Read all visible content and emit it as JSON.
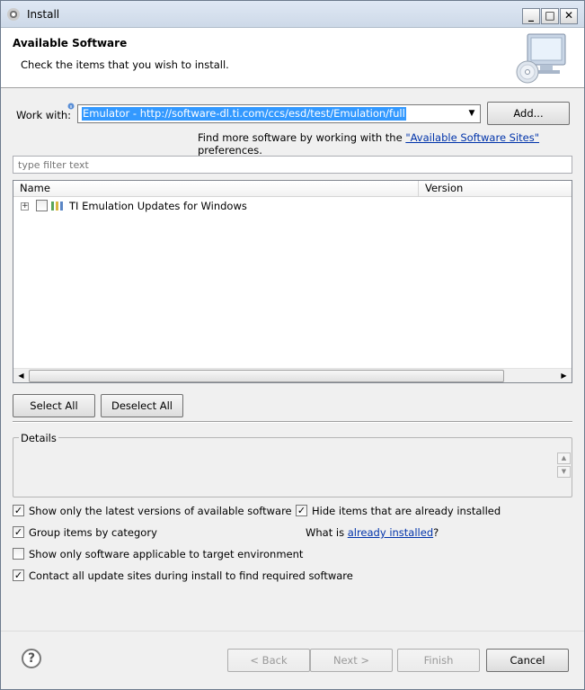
{
  "window": {
    "title": "Install",
    "minimize": "_",
    "maximize": "□",
    "close": "✕"
  },
  "header": {
    "title": "Available Software",
    "subtitle": "Check the items that you wish to install."
  },
  "work_with": {
    "label": "Work with:",
    "value": "Emulator - http://software-dl.ti.com/ccs/esd/test/Emulation/full",
    "add_label": "Add..."
  },
  "find_more": {
    "prefix": "Find more software by working with the ",
    "link": "\"Available Software Sites\"",
    "suffix": " preferences."
  },
  "filter": {
    "placeholder": "type filter text"
  },
  "table": {
    "columns": [
      "Name",
      "Version"
    ],
    "rows": [
      {
        "name": "TI Emulation Updates for Windows",
        "version": "",
        "checked": false,
        "expand": "+"
      }
    ]
  },
  "buttons": {
    "select_all": "Select All",
    "deselect_all": "Deselect All"
  },
  "details": {
    "label": "Details"
  },
  "options": {
    "latest_versions": "Show only the latest versions of available software",
    "hide_installed": "Hide items that are already installed",
    "group_by_category": "Group items by category",
    "what_is_prefix": "What is ",
    "what_is_link": "already installed",
    "what_is_suffix": "?",
    "target_env": "Show only software applicable to target environment",
    "contact_sites": "Contact all update sites during install to find required software"
  },
  "footer": {
    "help": "?",
    "back": "< Back",
    "next": "Next >",
    "finish": "Finish",
    "cancel": "Cancel"
  },
  "colors": {
    "selection": "#3399ff",
    "link": "#0033aa",
    "header_bg": "#ffffff",
    "dialog_bg": "#f0f0f0"
  }
}
